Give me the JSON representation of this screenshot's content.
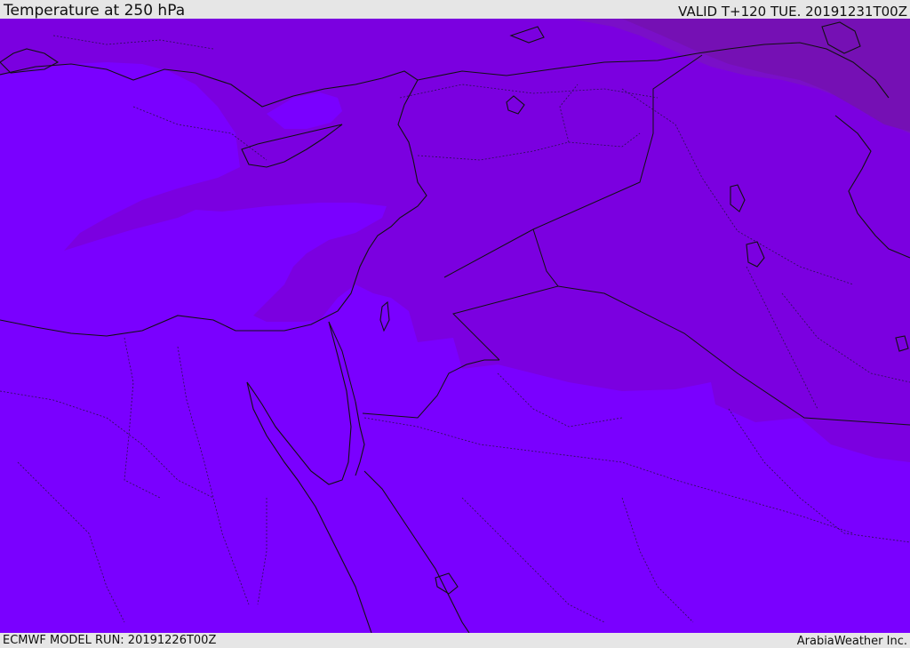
{
  "header": {
    "title": "Temperature at 250 hPa",
    "valid": "VALID T+120 TUE. 20191231T00Z"
  },
  "footer": {
    "model_run": "ECMWF MODEL RUN: 20191226T00Z",
    "credit": "ArabiaWeather Inc."
  },
  "map": {
    "colors": {
      "background": "#7a00ff",
      "band_1": "#7b00e0",
      "band_2": "#7a0fc8",
      "band_3": "#7510b4",
      "coast": "#111111",
      "border": "#2a1050"
    }
  }
}
